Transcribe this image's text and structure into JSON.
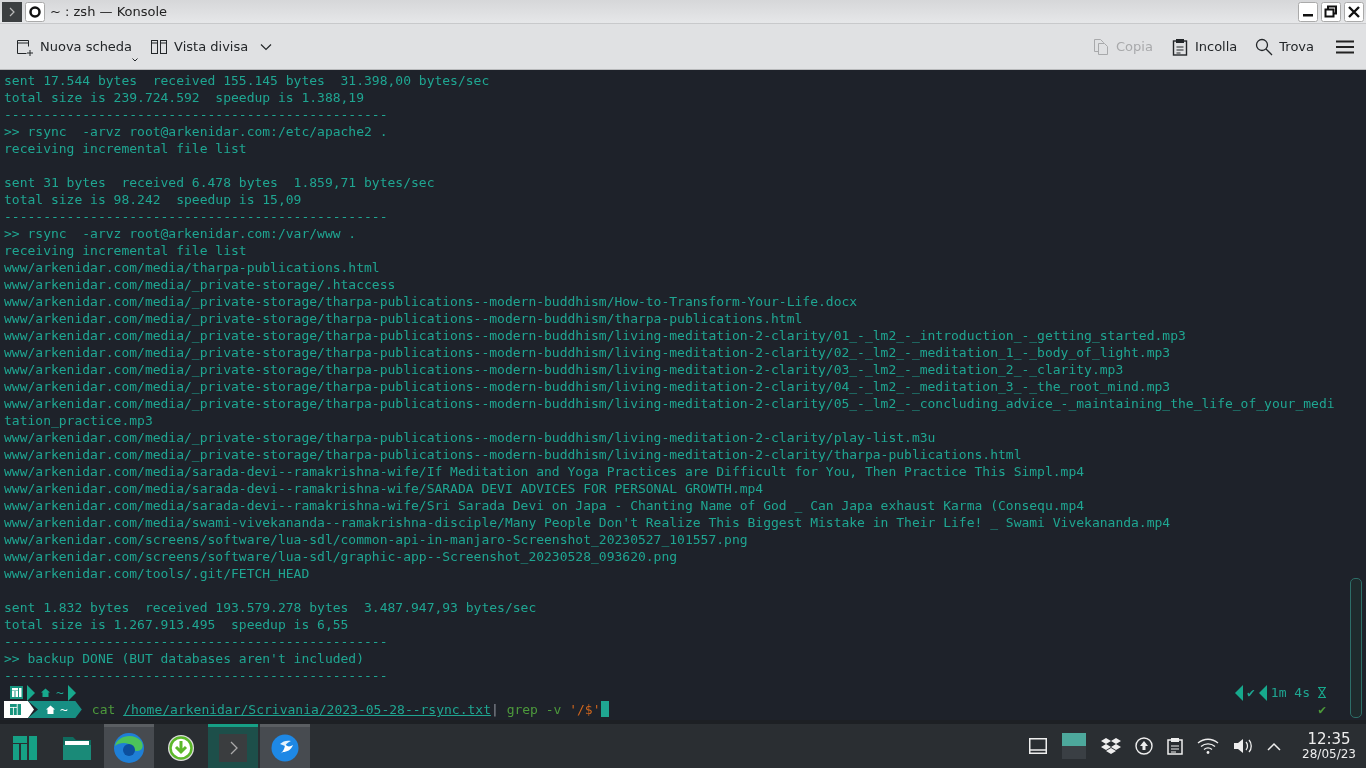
{
  "window": {
    "title": "~ : zsh — Konsole"
  },
  "toolbar": {
    "left": [
      {
        "label": "Nuova scheda",
        "kind": "new-tab",
        "disabled": false
      },
      {
        "label": "Vista divisa",
        "kind": "split",
        "disabled": false
      }
    ],
    "right": [
      {
        "label": "Copia",
        "kind": "copy",
        "disabled": true
      },
      {
        "label": "Incolla",
        "kind": "paste",
        "disabled": false
      },
      {
        "label": "Trova",
        "kind": "find",
        "disabled": false
      }
    ]
  },
  "terminal": {
    "blocks": [
      [
        "sent 17.544 bytes  received 155.145 bytes  31.398,00 bytes/sec",
        "total size is 239.724.592  speedup is 1.388,19",
        "-------------------------------------------------",
        ">> rsync  -arvz root@arkenidar.com:/etc/apache2 .",
        "receiving incremental file list"
      ],
      [
        "sent 31 bytes  received 6.478 bytes  1.859,71 bytes/sec",
        "total size is 98.242  speedup is 15,09",
        "-------------------------------------------------",
        ">> rsync  -arvz root@arkenidar.com:/var/www .",
        "receiving incremental file list",
        "www/arkenidar.com/media/tharpa-publications.html",
        "www/arkenidar.com/media/_private-storage/.htaccess",
        "www/arkenidar.com/media/_private-storage/tharpa-publications--modern-buddhism/How-to-Transform-Your-Life.docx",
        "www/arkenidar.com/media/_private-storage/tharpa-publications--modern-buddhism/tharpa-publications.html",
        "www/arkenidar.com/media/_private-storage/tharpa-publications--modern-buddhism/living-meditation-2-clarity/01_-_lm2_-_introduction_-_getting_started.mp3",
        "www/arkenidar.com/media/_private-storage/tharpa-publications--modern-buddhism/living-meditation-2-clarity/02_-_lm2_-_meditation_1_-_body_of_light.mp3",
        "www/arkenidar.com/media/_private-storage/tharpa-publications--modern-buddhism/living-meditation-2-clarity/03_-_lm2_-_meditation_2_-_clarity.mp3",
        "www/arkenidar.com/media/_private-storage/tharpa-publications--modern-buddhism/living-meditation-2-clarity/04_-_lm2_-_meditation_3_-_the_root_mind.mp3",
        "www/arkenidar.com/media/_private-storage/tharpa-publications--modern-buddhism/living-meditation-2-clarity/05_-_lm2_-_concluding_advice_-_maintaining_the_life_of_your_meditation_practice.mp3",
        "www/arkenidar.com/media/_private-storage/tharpa-publications--modern-buddhism/living-meditation-2-clarity/play-list.m3u",
        "www/arkenidar.com/media/_private-storage/tharpa-publications--modern-buddhism/living-meditation-2-clarity/tharpa-publications.html",
        "www/arkenidar.com/media/sarada-devi--ramakrishna-wife/If Meditation and Yoga Practices are Difficult for You, Then Practice This Simpl.mp4",
        "www/arkenidar.com/media/sarada-devi--ramakrishna-wife/SARADA DEVI ADVICES FOR PERSONAL GROWTH.mp4",
        "www/arkenidar.com/media/sarada-devi--ramakrishna-wife/Sri Sarada Devi on Japa - Chanting Name of God _ Can Japa exhaust Karma (Consequ.mp4",
        "www/arkenidar.com/media/swami-vivekananda--ramakrishna-disciple/Many People Don't Realize This Biggest Mistake in Their Life! _ Swami Vivekananda.mp4",
        "www/arkenidar.com/screens/software/lua-sdl/common-api-in-manjaro-Screenshot_20230527_101557.png",
        "www/arkenidar.com/screens/software/lua-sdl/graphic-app--Screenshot_20230528_093620.png",
        "www/arkenidar.com/tools/.git/FETCH_HEAD"
      ],
      [
        "sent 1.832 bytes  received 193.579.278 bytes  3.487.947,93 bytes/sec",
        "total size is 1.267.913.495  speedup is 6,55",
        "-------------------------------------------------",
        ">> backup DONE (BUT databases aren't included)",
        "-------------------------------------------------"
      ]
    ],
    "previous_prompt": {
      "dir": "~",
      "status": "✔",
      "duration": "1m 4s"
    },
    "prompt": {
      "dir": "~",
      "status": "✔",
      "tokens": [
        {
          "text": "cat",
          "kind": "command"
        },
        {
          "text": "/home/arkenidar/Scrivania/2023-05-28--rsync.txt",
          "kind": "path"
        },
        {
          "text": "|",
          "kind": "plain"
        },
        {
          "text": "grep",
          "kind": "command"
        },
        {
          "text": "-v",
          "kind": "command"
        },
        {
          "text": "'/$'",
          "kind": "string"
        }
      ]
    }
  },
  "taskbar": {
    "apps": [
      {
        "kind": "menu",
        "running": false,
        "selected": false
      },
      {
        "kind": "files",
        "running": false,
        "selected": false
      },
      {
        "kind": "browser",
        "running": true,
        "selected": false
      },
      {
        "kind": "download",
        "running": false,
        "selected": false
      },
      {
        "kind": "terminal",
        "running": true,
        "selected": true
      },
      {
        "kind": "bird",
        "running": true,
        "selected": false
      }
    ],
    "desktops": [
      {
        "selected": true
      },
      {
        "selected": false
      }
    ],
    "clock": {
      "time": "12:35",
      "date": "28/05/23"
    }
  }
}
